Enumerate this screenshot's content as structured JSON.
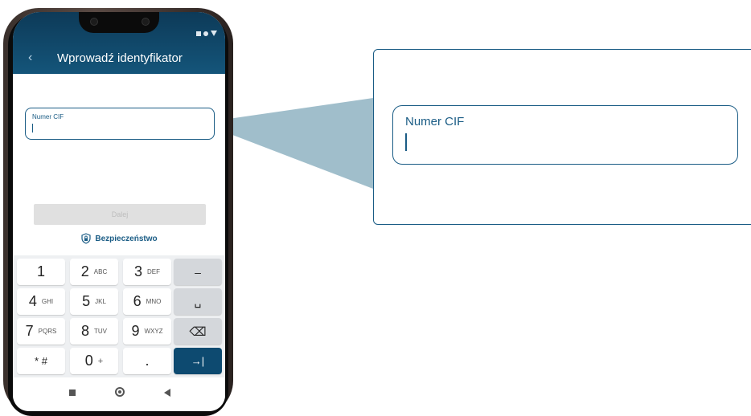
{
  "app": {
    "title": "Wprowadź identyfikator",
    "back_glyph": "‹"
  },
  "form": {
    "field_label": "Numer CIF",
    "field_value": ""
  },
  "actions": {
    "next_label": "Dalej",
    "security_label": "Bezpieczeństwo"
  },
  "keyboard": {
    "rows": [
      [
        {
          "main": "1",
          "sub": ""
        },
        {
          "main": "2",
          "sub": "ABC"
        },
        {
          "main": "3",
          "sub": "DEF"
        },
        {
          "main": "–",
          "sub": ""
        }
      ],
      [
        {
          "main": "4",
          "sub": "GHI"
        },
        {
          "main": "5",
          "sub": "JKL"
        },
        {
          "main": "6",
          "sub": "MNO"
        },
        {
          "main": "␣",
          "sub": ""
        }
      ],
      [
        {
          "main": "7",
          "sub": "PQRS"
        },
        {
          "main": "8",
          "sub": "TUV"
        },
        {
          "main": "9",
          "sub": "WXYZ"
        },
        {
          "main": "⌫",
          "sub": ""
        }
      ],
      [
        {
          "main": "* #",
          "sub": ""
        },
        {
          "main": "0",
          "sub": "+"
        },
        {
          "main": ".",
          "sub": ""
        },
        {
          "main": "→|",
          "sub": ""
        }
      ]
    ]
  },
  "zoom": {
    "field_label": "Numer CIF"
  },
  "colors": {
    "brand": "#0d3a58",
    "accent": "#1a5c85",
    "callout": "#8fb3c2"
  },
  "icons": {
    "back": "chevron-left-icon",
    "security": "shield-lock-icon",
    "backspace": "backspace-icon",
    "space": "space-icon",
    "tab": "tab-next-icon"
  }
}
